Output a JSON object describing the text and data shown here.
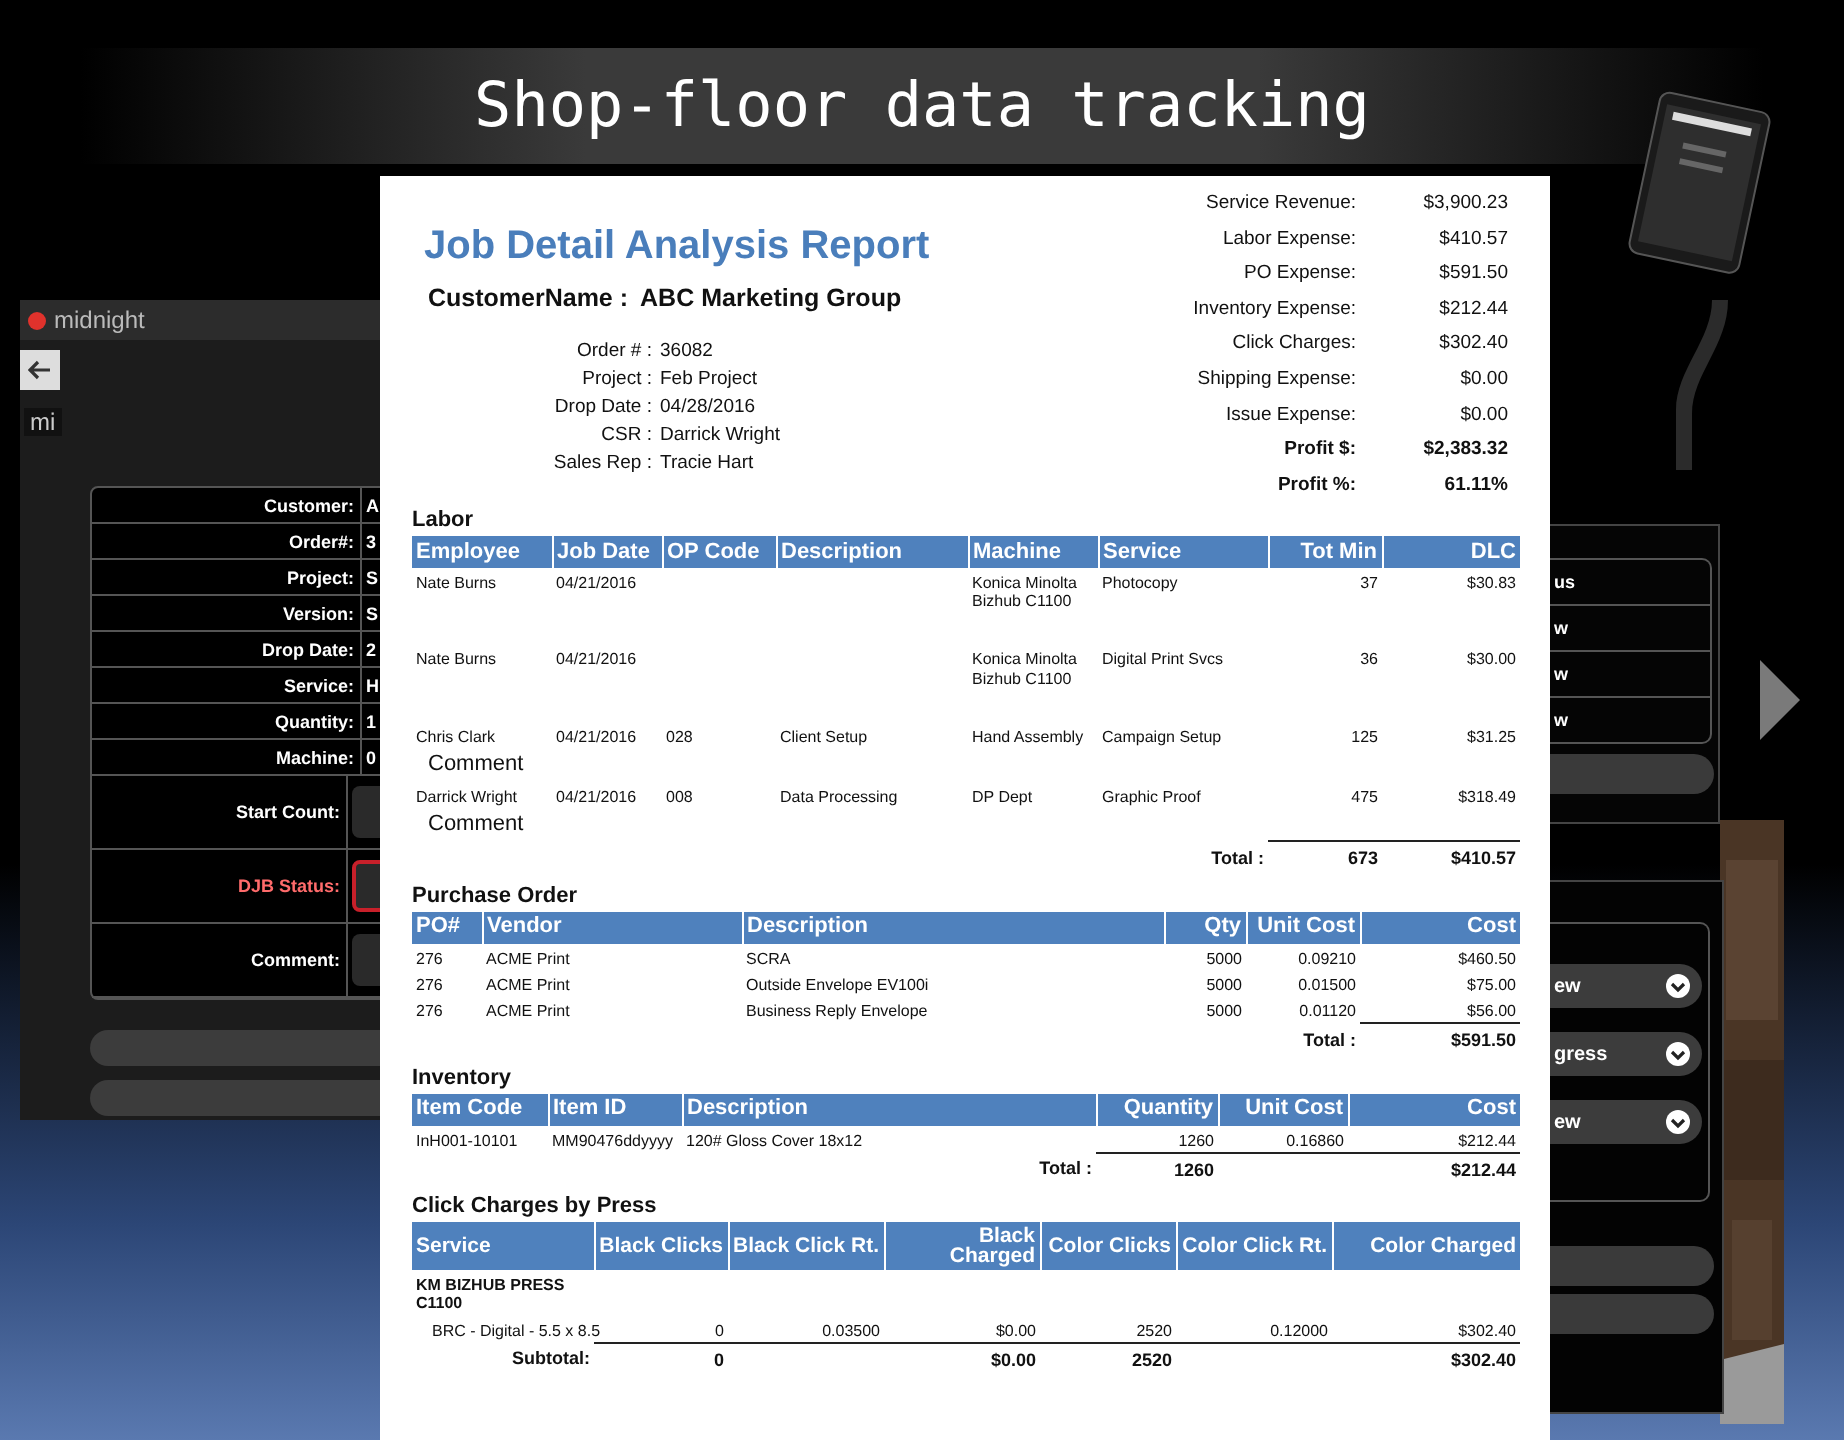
{
  "banner": {
    "title": "Shop-floor data tracking"
  },
  "left_app": {
    "title": "midnight",
    "subtitle": "mi",
    "fields": [
      {
        "label": "Customer:",
        "value": "A",
        "kind": "text",
        "invalid": false
      },
      {
        "label": "Order#:",
        "value": "3",
        "kind": "text",
        "invalid": false
      },
      {
        "label": "Project:",
        "value": "S",
        "kind": "text",
        "invalid": false
      },
      {
        "label": "Version:",
        "value": "S",
        "kind": "text",
        "invalid": false
      },
      {
        "label": "Drop Date:",
        "value": "2",
        "kind": "text",
        "invalid": false
      },
      {
        "label": "Service:",
        "value": "H",
        "kind": "text",
        "invalid": false
      },
      {
        "label": "Quantity:",
        "value": "1",
        "kind": "text",
        "invalid": false
      },
      {
        "label": "Machine:",
        "value": "0",
        "kind": "text",
        "invalid": false
      },
      {
        "label": "Start Count:",
        "kind": "input",
        "invalid": false
      },
      {
        "label": "DJB Status:",
        "kind": "select",
        "invalid": true
      },
      {
        "label": "Comment:",
        "kind": "input",
        "invalid": false
      }
    ]
  },
  "right_app": {
    "list": [
      "us",
      "w",
      "w",
      "w"
    ],
    "dropdowns": [
      "ew",
      "gress",
      "ew"
    ]
  },
  "report": {
    "title": "Job Detail Analysis Report",
    "customer": {
      "label": "CustomerName :",
      "value": "ABC Marketing Group"
    },
    "info": [
      {
        "label": "Order # :",
        "value": "36082"
      },
      {
        "label": "Project :",
        "value": "Feb Project"
      },
      {
        "label": "Drop Date :",
        "value": "04/28/2016"
      },
      {
        "label": "CSR :",
        "value": "Darrick Wright"
      },
      {
        "label": "Sales Rep :",
        "value": "Tracie Hart"
      }
    ],
    "summary": [
      {
        "label": "Service Revenue:",
        "value": "$3,900.23",
        "total": false
      },
      {
        "label": "Labor Expense:",
        "value": "$410.57",
        "total": false
      },
      {
        "label": "PO Expense:",
        "value": "$591.50",
        "total": false
      },
      {
        "label": "Inventory Expense:",
        "value": "$212.44",
        "total": false
      },
      {
        "label": "Click Charges:",
        "value": "$302.40",
        "total": false
      },
      {
        "label": "Shipping Expense:",
        "value": "$0.00",
        "total": false
      },
      {
        "label": "Issue Expense:",
        "value": "$0.00",
        "total": false
      },
      {
        "label": "Profit $:",
        "value": "$2,383.32",
        "total": true
      },
      {
        "label": "Profit %:",
        "value": "61.11%",
        "total": true
      }
    ],
    "sections": [
      {
        "title": "Labor",
        "columns": [
          "Employee",
          "Job Date",
          "OP Code",
          "Description",
          "Machine",
          "Service",
          "Tot Min",
          "DLC"
        ],
        "rows": [
          {
            "kind": "data",
            "cells": [
              "Nate Burns",
              "04/21/2016",
              null,
              null,
              "Konica Minolta Bizhub C1100",
              "Photocopy",
              "37",
              "$30.83"
            ]
          },
          {
            "kind": "data",
            "cells": [
              "Nate Burns",
              "04/21/2016",
              null,
              null,
              "Konica Minolta Bizhub C1100",
              "Digital Print Svcs",
              "36",
              "$30.00"
            ]
          },
          {
            "kind": "data",
            "cells": [
              "Chris Clark",
              "04/21/2016",
              "028",
              "Client Setup",
              "Hand Assembly",
              "Campaign Setup",
              "125",
              "$31.25"
            ],
            "comment": "Comment"
          },
          {
            "kind": "data",
            "cells": [
              "Darrick Wright",
              "04/21/2016",
              "008",
              "Data Processing",
              "DP Dept",
              "Graphic Proof",
              "475",
              "$318.49"
            ],
            "comment": "Comment"
          }
        ],
        "total": {
          "label": "Total :",
          "values": [
            "673",
            "$410.57"
          ]
        }
      },
      {
        "title": "Purchase Order",
        "columns": [
          "PO#",
          "Vendor",
          "Description",
          "Qty",
          "Unit Cost",
          "Cost"
        ],
        "rows": [
          {
            "kind": "data",
            "cells": [
              "276",
              "ACME Print",
              "SCRA",
              "5000",
              "0.09210",
              "$460.50"
            ]
          },
          {
            "kind": "data",
            "cells": [
              "276",
              "ACME Print",
              "Outside Envelope EV100i",
              "5000",
              "0.01500",
              "$75.00"
            ]
          },
          {
            "kind": "data",
            "cells": [
              "276",
              "ACME Print",
              "Business Reply Envelope",
              "5000",
              "0.01120",
              "$56.00"
            ]
          }
        ],
        "total": {
          "label": "Total :",
          "values": [
            "$591.50"
          ]
        }
      },
      {
        "title": "Inventory",
        "columns": [
          "Item Code",
          "Item ID",
          "Description",
          "Quantity",
          "Unit Cost",
          "Cost"
        ],
        "rows": [
          {
            "kind": "data",
            "cells": [
              "InH001-10101",
              "MM90476ddyyyy",
              "120# Gloss Cover 18x12",
              "1260",
              "0.16860",
              "$212.44"
            ]
          }
        ],
        "total": {
          "label": "Total :",
          "values": [
            "1260",
            "$212.44"
          ]
        }
      },
      {
        "title": "Click Charges by Press",
        "columns": [
          "Service",
          "Black Clicks",
          "Black Click Rt.",
          "Black Charged",
          "Color Clicks",
          "Color Click Rt.",
          "Color Charged"
        ],
        "rows": [
          {
            "kind": "group",
            "label": "KM BIZHUB PRESS C1100"
          },
          {
            "kind": "data",
            "cells": [
              "BRC - Digital - 5.5 x 8.5",
              "0",
              "0.03500",
              "$0.00",
              "2520",
              "0.12000",
              "$302.40"
            ]
          }
        ],
        "total": {
          "label": "Subtotal:",
          "values": [
            "0",
            "$0.00",
            "2520",
            "$302.40"
          ]
        }
      }
    ]
  }
}
